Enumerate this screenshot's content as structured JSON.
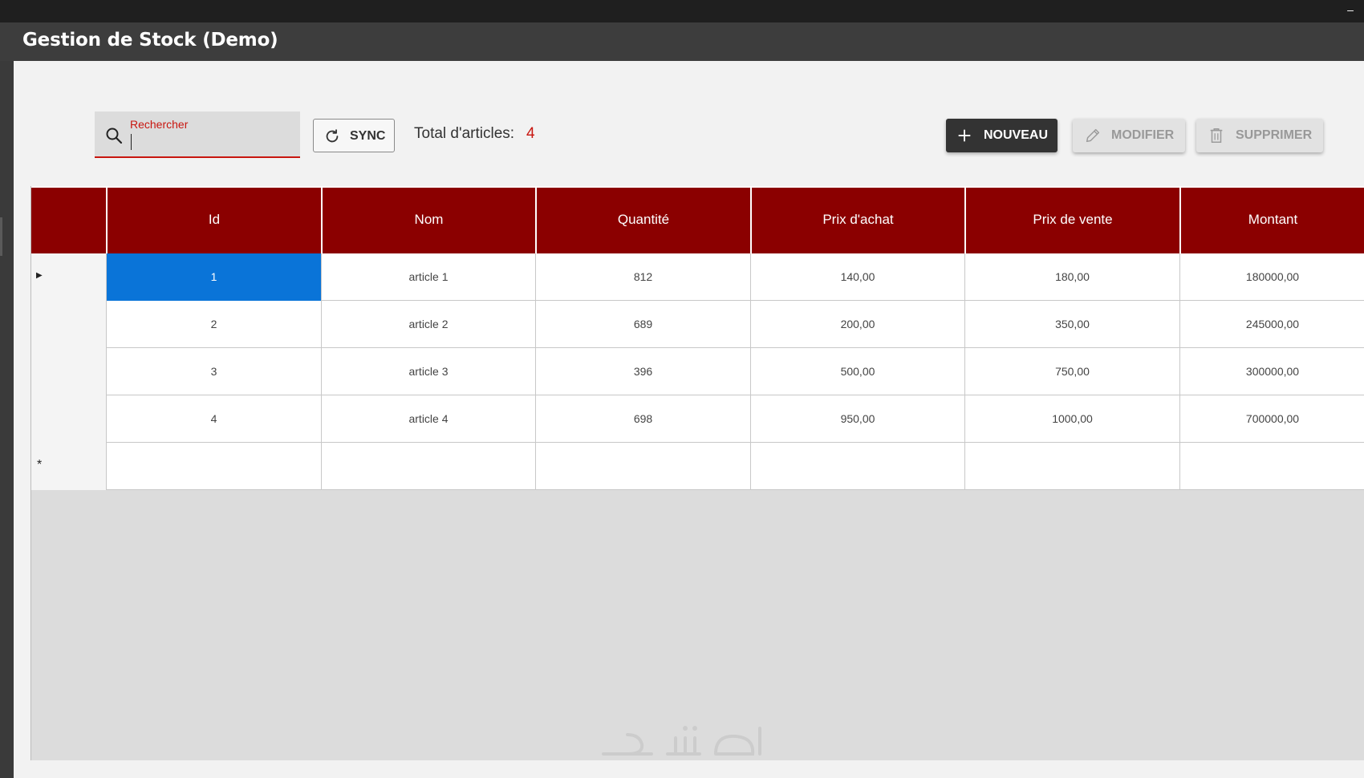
{
  "window": {
    "title": "Gestion de Stock (Demo)",
    "minimize_label": "–"
  },
  "toolbar": {
    "search_label": "Rechercher",
    "search_value": "",
    "sync_label": "SYNC",
    "total_label": "Total d'articles:",
    "total_value": "4",
    "new_label": "NOUVEAU",
    "edit_label": "MODIFIER",
    "delete_label": "SUPPRIMER"
  },
  "table": {
    "columns": [
      "Id",
      "Nom",
      "Quantité",
      "Prix d'achat",
      "Prix de vente",
      "Montant"
    ],
    "rows": [
      [
        "1",
        "article 1",
        "812",
        "140,00",
        "180,00",
        "180000,00"
      ],
      [
        "2",
        "article 2",
        "689",
        "200,00",
        "350,00",
        "245000,00"
      ],
      [
        "3",
        "article 3",
        "396",
        "500,00",
        "750,00",
        "300000,00"
      ],
      [
        "4",
        "article 4",
        "698",
        "950,00",
        "1000,00",
        "700000,00"
      ]
    ],
    "current_row_indicator": "▶",
    "new_row_indicator": "*"
  },
  "colors": {
    "accent_red": "#c8160f",
    "header_background": "#8b0000",
    "selection": "#0a74d8",
    "primary_button": "#333333"
  },
  "icons": {
    "search": "search-icon",
    "sync": "refresh-icon",
    "new": "plus-icon",
    "edit": "pencil-icon",
    "delete": "trash-icon"
  }
}
